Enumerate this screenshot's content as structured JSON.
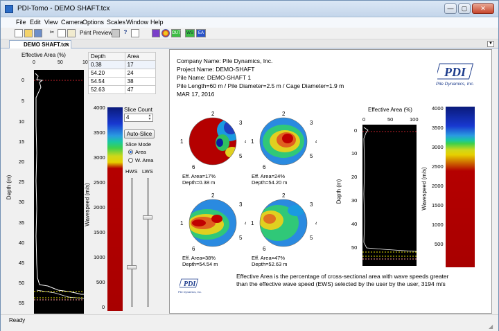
{
  "window": {
    "title": "PDI-Tomo - DEMO SHAFT.tcx",
    "min_label": "—",
    "max_label": "▢",
    "close_label": "✕"
  },
  "menu": [
    "File",
    "Edit",
    "View",
    "Camera",
    "Options",
    "Scales",
    "Window",
    "Help"
  ],
  "toolbar": {
    "print_preview": "Print Preview",
    "ws": "WS",
    "ea": "EA",
    "out": "OUT"
  },
  "tab": {
    "label": "DEMO SHAFT.tcx"
  },
  "left": {
    "ea_title": "Effective Area (%)",
    "ea_ticks": [
      "0",
      "50",
      "100"
    ],
    "depth_label": "Depth (m)",
    "depth_ticks": [
      "0",
      "5",
      "10",
      "15",
      "20",
      "25",
      "30",
      "35",
      "40",
      "45",
      "50",
      "55"
    ],
    "table": {
      "headers": [
        "Depth",
        "Area"
      ],
      "rows": [
        [
          "0.38",
          "17"
        ],
        [
          "54.20",
          "24"
        ],
        [
          "54.54",
          "38"
        ],
        [
          "52.63",
          "47"
        ]
      ]
    },
    "ws_ticks": [
      "4000",
      "3500",
      "3000",
      "2500",
      "2000",
      "1500",
      "1000",
      "500",
      "0"
    ],
    "wavespeed_label": "Wavespeed (m/s)",
    "slice_count_label": "Slice Count",
    "slice_count_value": "4",
    "auto_slice": "Auto-Slice",
    "slice_mode_label": "Slice Mode",
    "mode_area": "Area",
    "mode_warea": "W. Area",
    "hws": "HWS",
    "lws": "LWS",
    "hws_level": 0.3,
    "lws_level": 0.7
  },
  "report": {
    "company": "Company Name: Pile Dynamics, Inc.",
    "project": "Project Name: DEMO-SHAFT",
    "pile": "Pile Name: DEMO-SHAFT 1",
    "dims": "Pile Length=60 m / Pile Diameter=2.5 m / Cage Diameter=1.9 m",
    "date": "MAR 17, 2016",
    "logo_text": "PDI",
    "logo_sub": "Pile Dynamics, Inc.",
    "tomos": [
      {
        "area": "Eff. Area=17%",
        "depth": "Depth=0.38 m"
      },
      {
        "area": "Eff. Area=24%",
        "depth": "Depth=54.20 m"
      },
      {
        "area": "Eff. Area=38%",
        "depth": "Depth=54.54 m"
      },
      {
        "area": "Eff. Area=47%",
        "depth": "Depth=52.63 m"
      }
    ],
    "tube_labels": [
      "1",
      "2",
      "3",
      "4",
      "5",
      "6"
    ],
    "ea_title": "Effective Area (%)",
    "ea_ticks": [
      "0",
      "50",
      "100"
    ],
    "depth_label": "Depth (m)",
    "depth_ticks": [
      "0",
      "10",
      "20",
      "30",
      "40",
      "50"
    ],
    "ws_ticks": [
      "4000",
      "3500",
      "3000",
      "2500",
      "2000",
      "1500",
      "1000",
      "500"
    ],
    "wavespeed_label": "Wavespeed (m/s)",
    "note": "Effective Area is the percentage of cross-sectional area with wave speeds greater than the effective wave speed (EWS) selected by the user by the user, 3194 m/s",
    "small_logo": "PDI",
    "small_logo_sub": "Pile Dynamics, Inc."
  },
  "status": "Ready",
  "colors": {
    "red": "#b40000",
    "blue": "#0030b0",
    "green": "#10b840",
    "yellow": "#e8d800"
  }
}
